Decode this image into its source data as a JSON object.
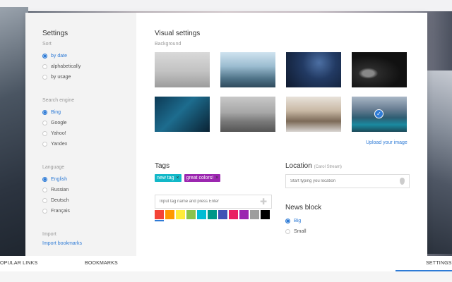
{
  "sidebar": {
    "title": "Settings",
    "sort": {
      "label": "Sort",
      "options": [
        "by date",
        "alphabetically",
        "by usage"
      ]
    },
    "search_engine": {
      "label": "Search engine",
      "options": [
        "Bing",
        "Google",
        "Yahoo!",
        "Yandex"
      ]
    },
    "language": {
      "label": "Language",
      "options": [
        "English",
        "Russian",
        "Deutsch",
        "Français"
      ]
    },
    "import": {
      "label": "Import",
      "link": "Import bookmarks"
    }
  },
  "visual": {
    "title": "Visual settings",
    "background_label": "Background",
    "upload_link": "Upload your image",
    "selected_index": 7
  },
  "tags": {
    "title": "Tags",
    "items": [
      {
        "label": "new tag",
        "x": "×",
        "color": "#12b8c8"
      },
      {
        "label": "great colors!",
        "x": "×",
        "color": "#9c27b0"
      }
    ],
    "input_placeholder": "Input tag name and press Enter",
    "palette": [
      "#f44336",
      "#ff9800",
      "#ffeb3b",
      "#8bc34a",
      "#00bcd4",
      "#009688",
      "#3f51b5",
      "#e91e63",
      "#9c27b0",
      "#9e9e9e",
      "#000000"
    ]
  },
  "location": {
    "title": "Location",
    "subtitle": "(Carol Stream)",
    "placeholder": "Start typing you location"
  },
  "news_block": {
    "title": "News block",
    "options": [
      "Big",
      "Small"
    ]
  },
  "bottom_nav": {
    "popular": "OPULAR LINKS",
    "bookmarks": "BOOKMARKS",
    "settings": "SETTINGS"
  },
  "colors": {
    "accent": "#2e7bd6"
  }
}
